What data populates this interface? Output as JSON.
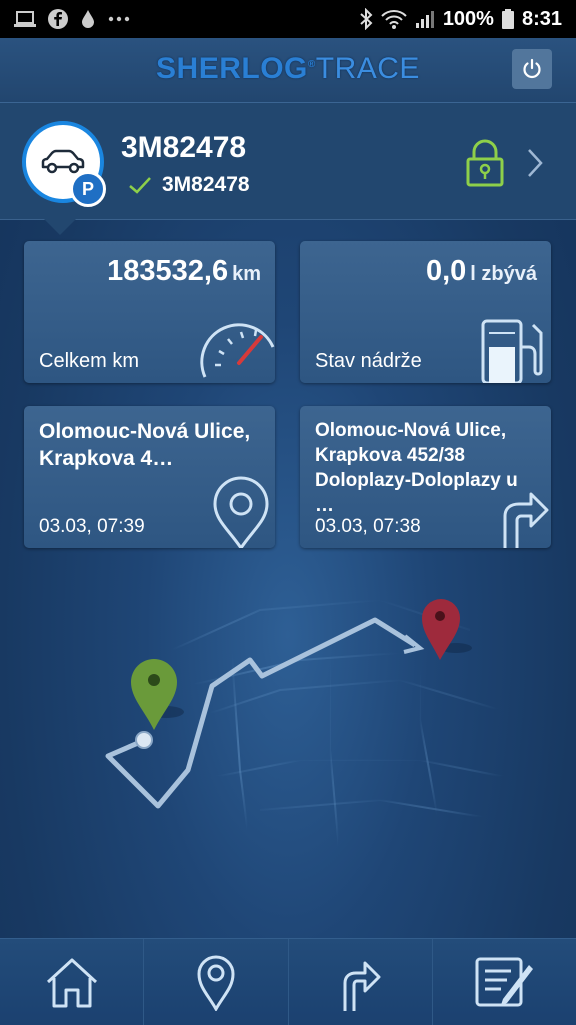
{
  "status_bar": {
    "battery": "100%",
    "time": "8:31",
    "icons": [
      "laptop-icon",
      "facebook-icon",
      "water-drop-icon",
      "more-icon",
      "bluetooth-icon",
      "wifi-icon",
      "signal-icon"
    ]
  },
  "header": {
    "logo_bold": "SHERLOG",
    "logo_reg": "®",
    "logo_light": "TRACE",
    "power_icon": "power-icon"
  },
  "vehicle": {
    "name": "3M82478",
    "sub_name": "3M82478",
    "badge": "P",
    "status_color": "#8ed04a"
  },
  "tiles": {
    "odometer": {
      "value": "183532,6",
      "unit": "km",
      "label": "Celkem km"
    },
    "fuel": {
      "value": "0,0",
      "unit": "l zbývá",
      "label": "Stav nádrže"
    },
    "location": {
      "address": "Olomouc-Nová Ulice, Krapkova 4…",
      "time": "03.03, 07:39"
    },
    "trip": {
      "address": "Olomouc-Nová Ulice, Krapkova 452/38 Doloplazy-Doloplazy u …",
      "time": "03.03, 07:38"
    }
  },
  "bottom_nav": {
    "items": [
      "home-icon",
      "location-pin-icon",
      "route-arrow-icon",
      "edit-note-icon"
    ]
  },
  "colors": {
    "accent": "#1a86e0",
    "pin_start": "#6a9a3a",
    "pin_end": "#9e2a3c"
  }
}
